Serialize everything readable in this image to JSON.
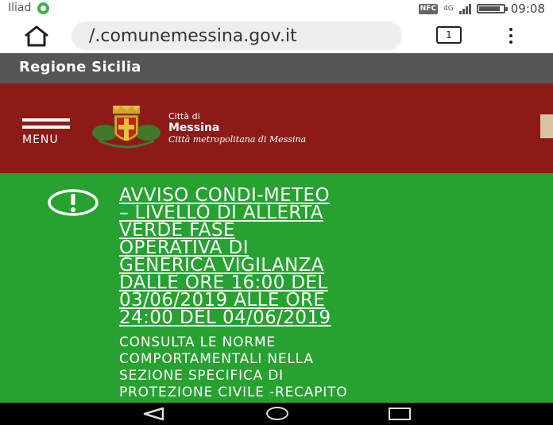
{
  "status_bar": {
    "carrier": "Iliad",
    "nfc": "NFC",
    "network": "4G",
    "time": "09:08",
    "battery_level": 0.85
  },
  "browser": {
    "url": "/.comunemessina.gov.it",
    "tab_count": "1"
  },
  "site": {
    "region": "Regione Sicilia",
    "menu_label": "MENU",
    "city_prefix": "Città di",
    "city_name": "Messina",
    "metro_label": "Città metropolitana di Messina"
  },
  "alert": {
    "title_lines": [
      "AVVISO CONDI-METEO",
      "– LIVELLO DI ALLERTA",
      "VERDE FASE",
      "OPERATIVA DI",
      "GENERICA VIGILANZA",
      "DALLE ORE 16:00 DEL",
      "03/06/2019 ALLE ORE",
      "24:00 DEL 04/06/2019"
    ],
    "body_lines": [
      "CONSULTA LE NORME",
      "COMPORTAMENTALI NELLA",
      "SEZIONE SPECIFICA DI",
      "PROTEZIONE CIVILE -RECAPITO"
    ]
  },
  "icons": {
    "home": "home-icon",
    "tabs": "tabs-icon",
    "menu": "more-vert-icon",
    "alert": "exclamation-icon",
    "back": "nav-back-icon",
    "nav_home": "nav-home-icon",
    "recents": "nav-recents-icon"
  },
  "colors": {
    "header_red": "#8c1a17",
    "alert_green": "#27a130",
    "regione_gray": "#555555"
  }
}
